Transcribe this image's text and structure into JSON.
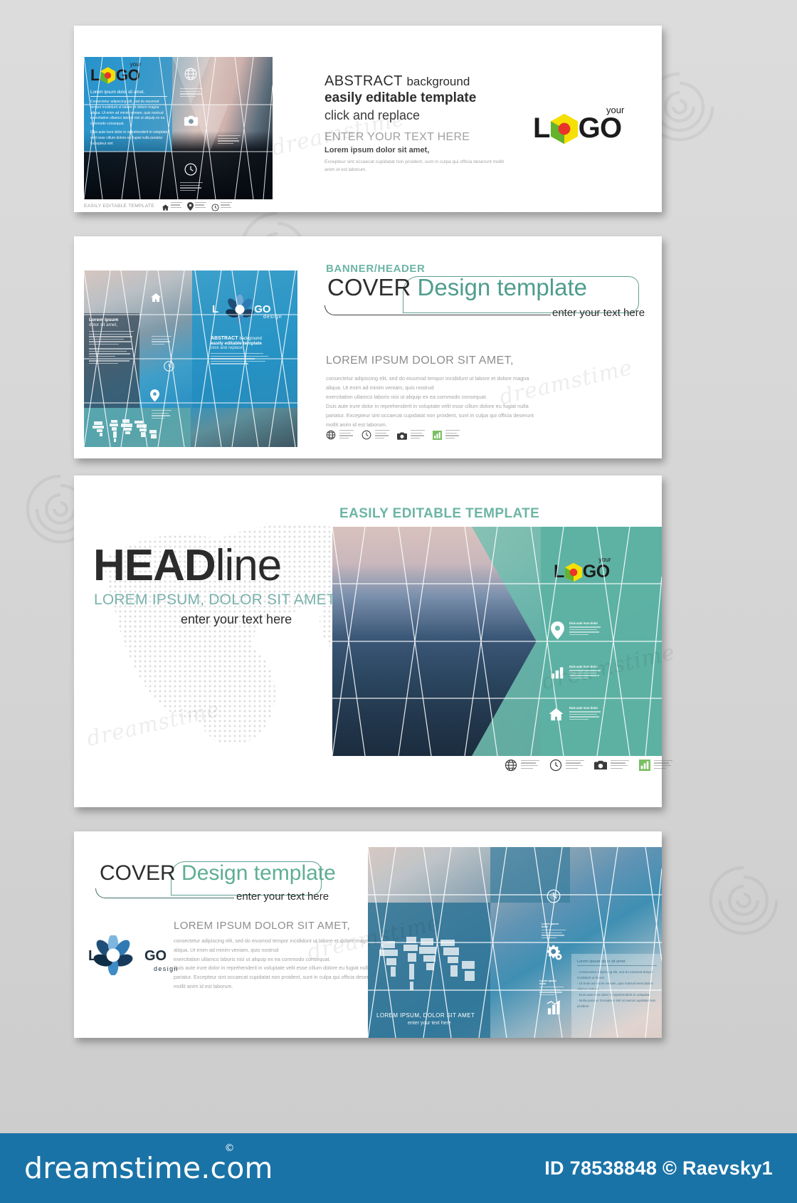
{
  "stock": {
    "site": "dreamstime.com",
    "registered_mark": "©",
    "id_line": "ID 78538848 © Raevsky1",
    "watermark_text": "dreamstime"
  },
  "colors": {
    "footer_blue": "#1a73a7",
    "teal": "#6cb5a4",
    "teal_dark": "#4f9d8d",
    "logo_yellow": "#f5e003",
    "logo_red": "#e8342a",
    "logo_green": "#63b32e",
    "ink": "#1c1c1c",
    "body_grey": "#9a9a9a"
  },
  "banner1": {
    "thumb": {
      "logo": {
        "left": "L",
        "right": "GO",
        "your": "your"
      },
      "heading": "Lorem ipsum dolor sit amet.",
      "para1": "Consectetur adipiscing elit, sed do eiusmod tempor incididunt ut labore et dolore magna aliqua. Ut enim ad minim veniam, quis nostrud exercitation ullamco laboris nisi ut aliquip ex ea commodo consequat.",
      "para2": "Duis aute irure dolor in reprehenderit in voluptate velit esse cillum dolore eu fugiat nulla pariatur. Excepteur sint",
      "footer_label": "EASILY EDITABLE TEMPLATE",
      "icons": [
        "globe-icon",
        "camera-icon",
        "clock-icon"
      ],
      "footer_icons": [
        "home-icon",
        "location-pin-icon",
        "clock-icon"
      ]
    },
    "title_line1_strong": "ABSTRACT",
    "title_line1_light": "background",
    "title_line2": "easily editable template",
    "title_line3": "click and replace",
    "subhead": "ENTER YOUR TEXT HERE",
    "subhead2": "Lorem ipsum dolor sit amet,",
    "body": "Excepteur sint occaecat cupidatat non proident, sunt in culpa qui officia deserunt mollit anim id est laborum.",
    "logo": {
      "left": "L",
      "right": "GO",
      "your": "your"
    }
  },
  "banner2": {
    "eyebrow": "BANNER/HEADER",
    "title_dark": "COVER",
    "title_teal": "Design template",
    "tagline": "enter your text here",
    "heading": "LOREM IPSUM DOLOR SIT AMET,",
    "body": "consectetur adipiscing elit, sed do eiusmod tempor incididunt ut labore et dolore magna aliqua. Ut enim ad minim veniam, quis nostrud\nexercitation ullamco laboris nisi ut aliquip ex ea commodo consequat.\nDuis aute irure dolor in reprehenderit in voluptate velit esse cillum dolore eu fugiat nulla pariatur. Excepteur sint occaecat cupidatat non proident, sunt in culpa qui officia deserunt mollit anim id est laborum.",
    "icons": [
      "globe-icon",
      "clock-icon",
      "camera-icon",
      "chart-icon"
    ],
    "thumb": {
      "logo": {
        "left": "L",
        "right": "GO",
        "sub": "design"
      },
      "heading": "Lorem ipsum",
      "subheading": "dolor sit amet,",
      "panel_title_strong": "ABSTRACT",
      "panel_title_light": "background",
      "panel_line2": "easily editable template",
      "panel_line3": "click and replace",
      "icons": [
        "home-icon",
        "clock-icon",
        "location-pin-icon",
        "world-map-icon"
      ]
    }
  },
  "banner3": {
    "headline_bold": "HEAD",
    "headline_light": "line",
    "subhead": "LOREM IPSUM, DOLOR SIT AMET",
    "tagline": "enter your text here",
    "badge": "EASILY EDITABLE TEMPLATE",
    "logo": {
      "left": "L",
      "right": "GO",
      "your": "your"
    },
    "features": [
      {
        "icon": "location-pin-icon",
        "title": "Duis aute irure dolor",
        "text": "Lorem ipsum dolor sit amet consectetur adipiscing elit sed do eiusmod tempor"
      },
      {
        "icon": "bar-chart-icon",
        "title": "Duis aute irure dolor",
        "text": "Lorem ipsum dolor sit amet consectetur adipiscing elit sed do eiusmod tempor"
      },
      {
        "icon": "home-icon",
        "title": "Duis aute irure dolor",
        "text": "Lorem ipsum dolor sit amet consectetur adipiscing elit sed do eiusmod tempor"
      }
    ],
    "footer_icons": [
      "globe-icon",
      "clock-icon",
      "camera-icon",
      "chart-icon"
    ]
  },
  "banner4": {
    "title_dark": "COVER",
    "title_teal": "Design template",
    "tagline": "enter your text here",
    "heading": "LOREM IPSUM DOLOR SIT AMET,",
    "body": "consectetur adipiscing elit, sed do eiusmod tempor incididunt ut labore et dolore magna aliqua. Ut enim ad minim veniam, quis nostrud\nexercitation ullamco laboris nisi ut aliquip ex ea commodo consequat.\nDuis aute irure dolor in reprehenderit in voluptate velit esse cillum dolore eu fugiat nulla pariatur. Excepteur sint occaecat cupidatat non proident, sunt in culpa qui officia deserunt mollit anim id est laborum.",
    "logo": {
      "left": "L",
      "right": "GO",
      "sub": "design"
    },
    "thumb": {
      "caption_main": "LOREM IPSUM, DOLOR SIT AMET",
      "caption_sub": "enter your text here",
      "icons": [
        "clock-icon",
        "gears-icon",
        "chart-icon",
        "world-map-icon"
      ],
      "side_heading": "Lorem ipsum dolor sit amet",
      "side_body": "- Consectetur adipiscing elit, sed do eiusmod tempor incididunt ut labore\n- Ut enim ad minim veniam, quis nostrud exercitation ullamco laboris\n- Duis aute irure dolor in reprehenderit in voluptate\n- Nulla pariatur. Excepteur sint occaecat cupidatat non proident"
    }
  }
}
